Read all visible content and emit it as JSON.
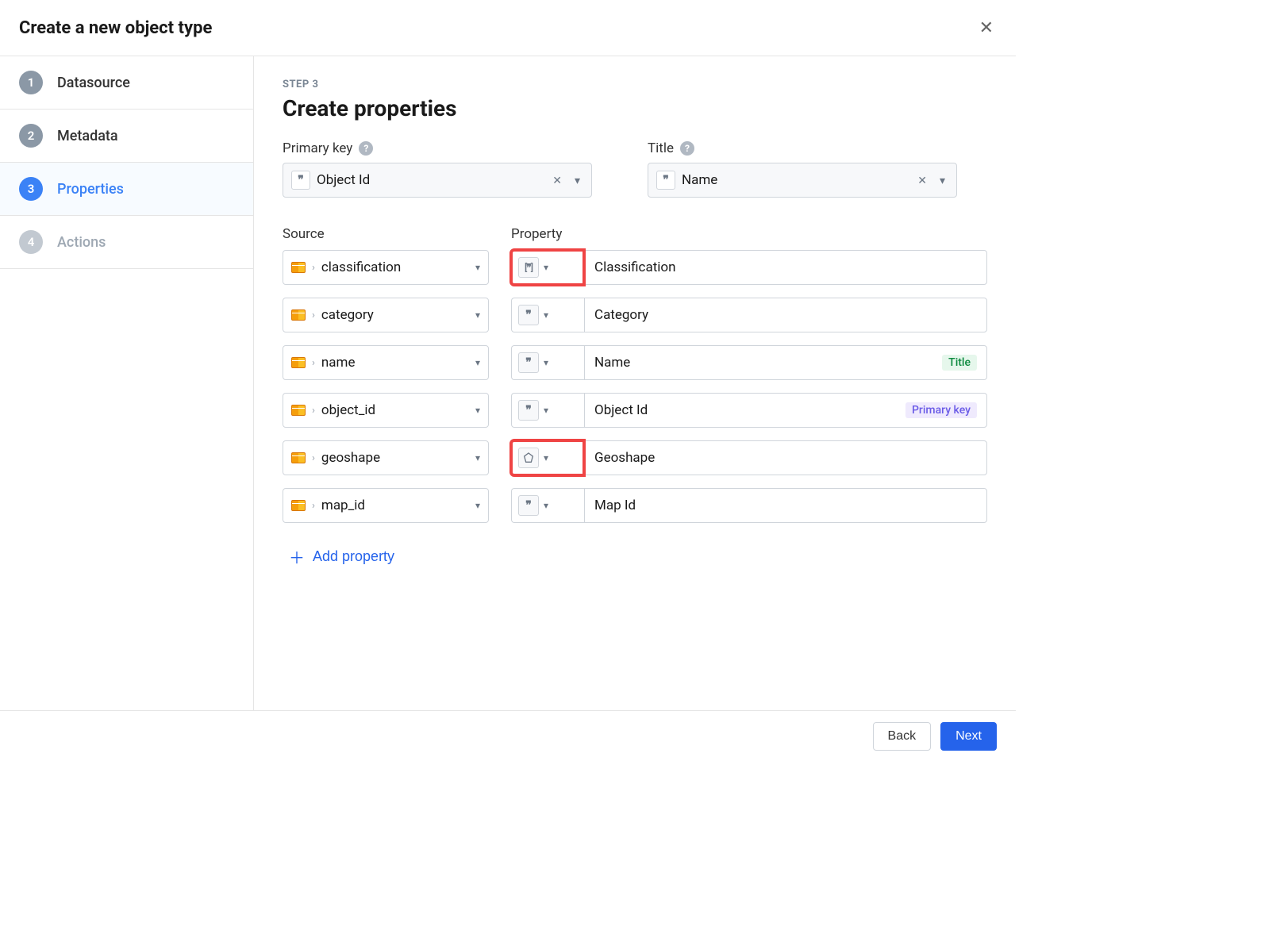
{
  "dialog": {
    "title": "Create a new object type",
    "close_label": "Close"
  },
  "steps": [
    {
      "number": "1",
      "label": "Datasource",
      "state": "completed"
    },
    {
      "number": "2",
      "label": "Metadata",
      "state": "completed"
    },
    {
      "number": "3",
      "label": "Properties",
      "state": "active"
    },
    {
      "number": "4",
      "label": "Actions",
      "state": "disabled"
    }
  ],
  "main": {
    "step_indicator": "STEP 3",
    "heading": "Create properties",
    "primary_key": {
      "label": "Primary key",
      "value": "Object Id"
    },
    "title_field": {
      "label": "Title",
      "value": "Name"
    },
    "columns": {
      "source": "Source",
      "property": "Property"
    }
  },
  "properties": [
    {
      "source": "classification",
      "type": "array",
      "name": "Classification",
      "badge": null,
      "highlighted": true
    },
    {
      "source": "category",
      "type": "string",
      "name": "Category",
      "badge": null,
      "highlighted": false
    },
    {
      "source": "name",
      "type": "string",
      "name": "Name",
      "badge": "Title",
      "highlighted": false
    },
    {
      "source": "object_id",
      "type": "string",
      "name": "Object Id",
      "badge": "Primary key",
      "highlighted": false
    },
    {
      "source": "geoshape",
      "type": "geo",
      "name": "Geoshape",
      "badge": null,
      "highlighted": true
    },
    {
      "source": "map_id",
      "type": "string",
      "name": "Map Id",
      "badge": null,
      "highlighted": false
    }
  ],
  "actions": {
    "add_property": "Add property",
    "back": "Back",
    "next": "Next"
  }
}
